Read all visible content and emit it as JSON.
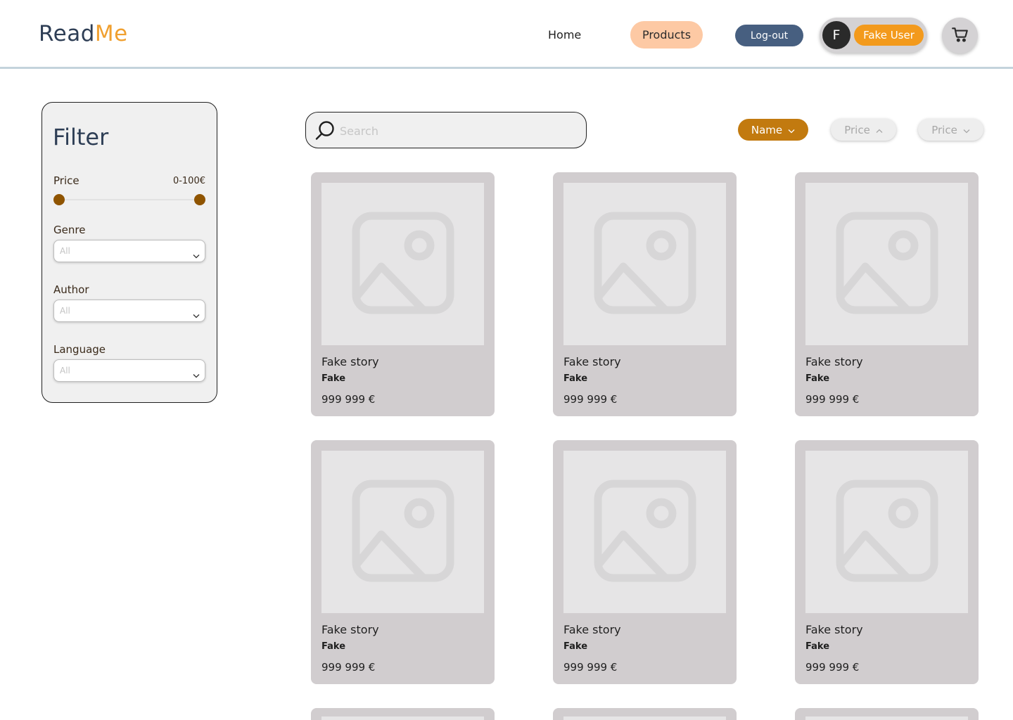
{
  "header": {
    "logo_part1": "Read",
    "logo_part2": "Me",
    "nav_home": "Home",
    "nav_products": "Products",
    "logout": "Log-out",
    "avatar_initial": "F",
    "user_name": "Fake User",
    "cart_icon": "cart-icon"
  },
  "filter": {
    "title": "Filter",
    "price_label": "Price",
    "price_range": "0-100€",
    "genre_label": "Genre",
    "genre_value": "All",
    "author_label": "Author",
    "author_value": "All",
    "language_label": "Language",
    "language_value": "All"
  },
  "search": {
    "placeholder": "Search",
    "icon": "search-icon"
  },
  "sort": {
    "name_label": "Name",
    "price_asc_label": "Price",
    "price_desc_label": "Price"
  },
  "products": [
    {
      "title": "Fake story",
      "author": "Fake",
      "price": "999 999 €"
    },
    {
      "title": "Fake story",
      "author": "Fake",
      "price": "999 999 €"
    },
    {
      "title": "Fake story",
      "author": "Fake",
      "price": "999 999 €"
    },
    {
      "title": "Fake story",
      "author": "Fake",
      "price": "999 999 €"
    },
    {
      "title": "Fake story",
      "author": "Fake",
      "price": "999 999 €"
    },
    {
      "title": "Fake story",
      "author": "Fake",
      "price": "999 999 €"
    }
  ],
  "colors": {
    "accent_orange": "#f39a1c",
    "sort_active": "#c27a0f",
    "slider_knob": "#8f5400",
    "logout_bg": "#475f80",
    "products_bg": "#fdc9a4",
    "logo_dark": "#2e3e55"
  }
}
